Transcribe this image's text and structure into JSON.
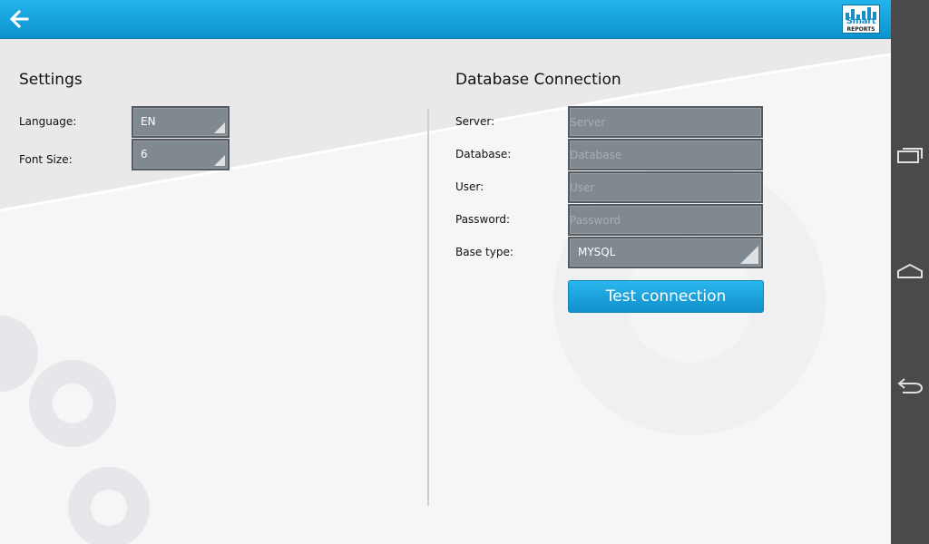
{
  "topbar": {
    "back_icon": "arrow-left-icon",
    "logo": {
      "line1": "Smart",
      "line2": "REPORTS"
    }
  },
  "settings": {
    "title": "Settings",
    "language": {
      "label": "Language:",
      "value": "EN"
    },
    "font_size": {
      "label": "Font Size:",
      "value": "6"
    }
  },
  "db": {
    "title": "Database Connection",
    "server": {
      "label": "Server:",
      "placeholder": "Server",
      "value": ""
    },
    "database": {
      "label": "Database:",
      "placeholder": "Database",
      "value": ""
    },
    "user": {
      "label": "User:",
      "placeholder": "User",
      "value": ""
    },
    "password": {
      "label": "Password:",
      "placeholder": "Password",
      "value": ""
    },
    "base_type": {
      "label": "Base type:",
      "value": "MYSQL"
    },
    "test_button": "Test connection"
  },
  "navbar": {
    "recent_icon": "recent-apps-icon",
    "home_icon": "home-icon",
    "back_icon": "back-icon"
  },
  "colors": {
    "accent": "#1aa3de",
    "field_bg": "#808890",
    "navbar_bg": "#4a4a4a"
  }
}
